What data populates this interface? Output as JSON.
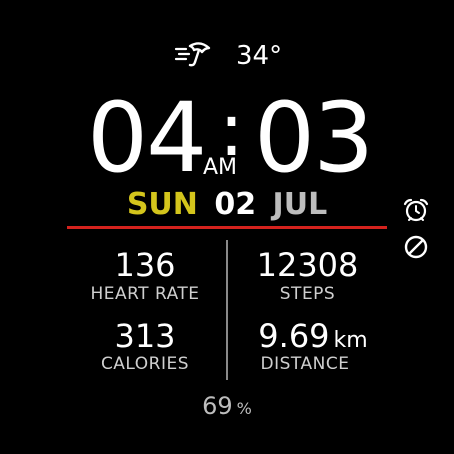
{
  "weather": {
    "icon": "windy-umbrella-icon",
    "temperature": "34°"
  },
  "time": {
    "hour": "04",
    "separator": ":",
    "minute": "03",
    "ampm": "AM"
  },
  "date": {
    "day": "SUN",
    "day_number": "02",
    "month": "JUL"
  },
  "status_icons": [
    "alarm-icon",
    "do-not-disturb-icon"
  ],
  "stats": {
    "heart_rate": {
      "value": "136",
      "label": "HEART RATE"
    },
    "steps": {
      "value": "12308",
      "label": "STEPS"
    },
    "calories": {
      "value": "313",
      "label": "CALORIES"
    },
    "distance": {
      "value": "9.69",
      "unit": "km",
      "label": "DISTANCE"
    }
  },
  "battery": {
    "value": "69",
    "unit": "%"
  },
  "colors": {
    "background": "#000000",
    "day_accent": "#d4c51c",
    "divider_red": "#d4221d",
    "text": "#ffffff",
    "muted": "#bdbdbd"
  }
}
